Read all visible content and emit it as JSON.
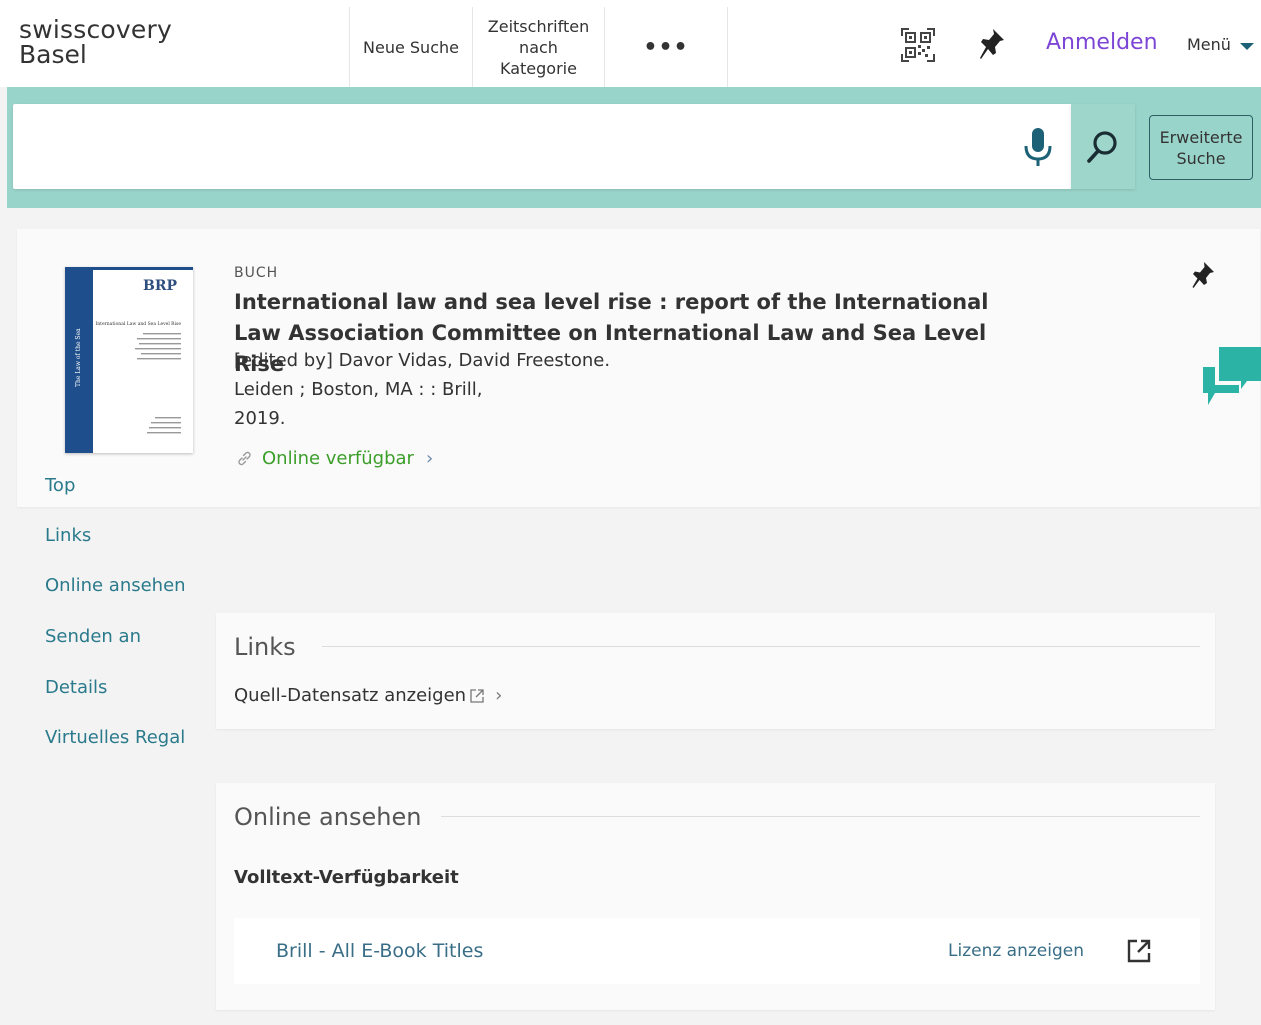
{
  "header": {
    "logo_line1": "swisscovery",
    "logo_line2": "Basel",
    "nav": {
      "new_search": "Neue Suche",
      "journals_l1": "Zeitschriften",
      "journals_l2": "nach",
      "journals_l3": "Kategorie",
      "more": "•••"
    },
    "login": "Anmelden",
    "menu": "Menü"
  },
  "search": {
    "value": "",
    "advanced_l1": "Erweiterte",
    "advanced_l2": "Suche"
  },
  "record": {
    "type": "BUCH",
    "title": "International law and sea level rise : report of the International Law Association Committee on International Law and Sea Level Rise",
    "authors": "[edited by] Davor Vidas, David Freestone.",
    "publisher": "Leiden ; Boston, MA : : Brill,",
    "year": "2019.",
    "availability": "Online verfügbar",
    "cover_text": {
      "brand": "BRP",
      "title": "International Law and Sea Level Rise",
      "spine": "The Law of the Sea"
    }
  },
  "sidenav": [
    "Top",
    "Links",
    "Online ansehen",
    "Senden an",
    "Details",
    "Virtuelles Regal"
  ],
  "links_section": {
    "title": "Links",
    "item": "Quell-Datensatz anzeigen"
  },
  "online_section": {
    "title": "Online ansehen",
    "subtitle": "Volltext-Verfügbarkeit",
    "holding_title": "Brill - All E-Book Titles",
    "license": "Lizenz anzeigen"
  },
  "colors": {
    "teal_band": "#99d4ca",
    "login_purple": "#7d45d6",
    "link_teal": "#2a7a8c",
    "available_green": "#3b9e2a",
    "icon_dark_teal": "#1d6177"
  }
}
